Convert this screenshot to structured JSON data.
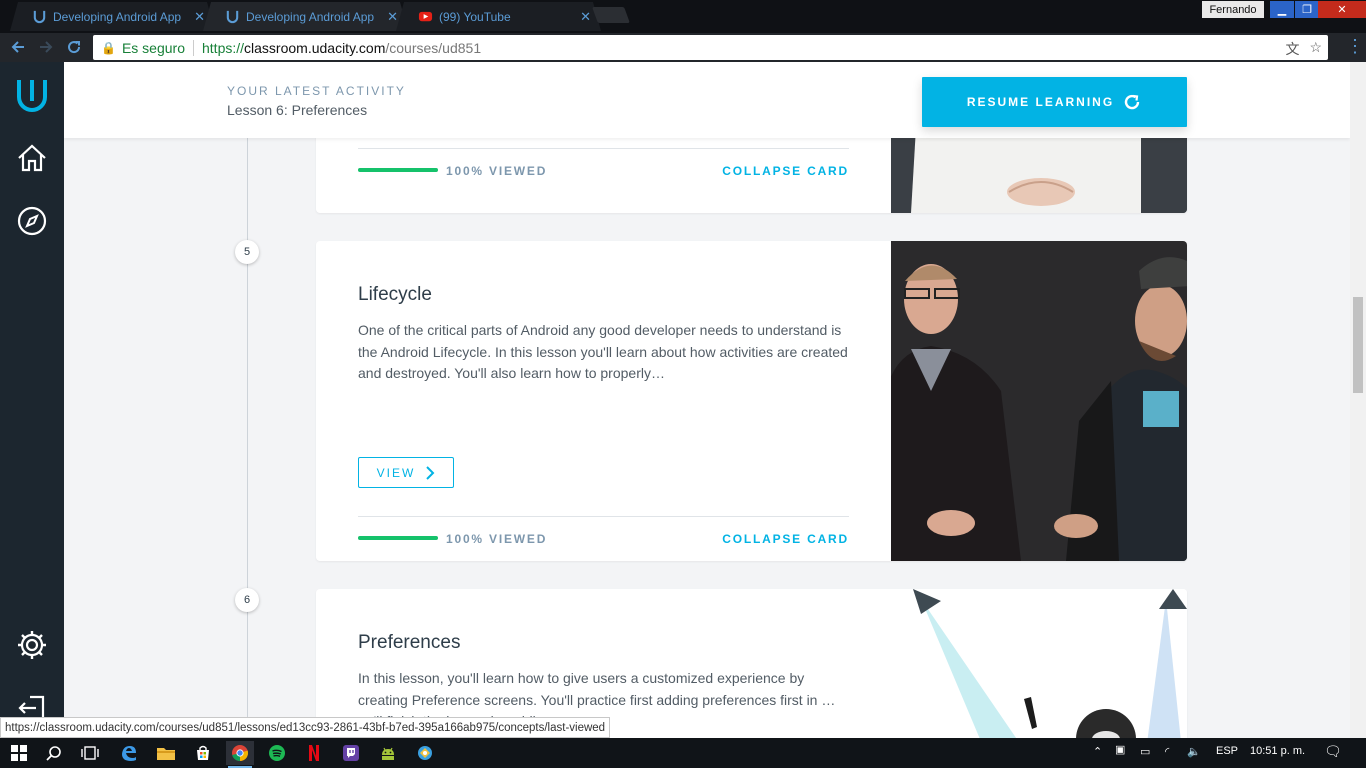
{
  "browser": {
    "tabs": [
      {
        "title": "Developing Android App",
        "favicon": "udacity-logo-icon",
        "active": false
      },
      {
        "title": "Developing Android App",
        "favicon": "udacity-logo-icon",
        "active": true
      },
      {
        "title": "(99) YouTube",
        "favicon": "youtube-icon",
        "active": false
      }
    ],
    "profile_name": "Fernando",
    "security_label": "Es seguro",
    "url_scheme": "https://",
    "url_host": "classroom.udacity.com",
    "url_path": "/courses/ud851",
    "status_url": "https://classroom.udacity.com/courses/ud851/lessons/ed13cc93-2861-43bf-b7ed-395a166ab975/concepts/last-viewed"
  },
  "sidebar": {
    "items": [
      {
        "icon": "udacity-logo-icon"
      },
      {
        "icon": "home-icon"
      },
      {
        "icon": "compass-icon"
      },
      {
        "icon": "gear-icon"
      },
      {
        "icon": "logout-icon"
      }
    ]
  },
  "activity": {
    "label": "YOUR LATEST ACTIVITY",
    "lesson": "Lesson 6: Preferences",
    "resume_label": "RESUME LEARNING"
  },
  "lessons": [
    {
      "number": "",
      "viewed_label": "100% VIEWED",
      "progress": 1.0,
      "collapse_label": "COLLAPSE CARD"
    },
    {
      "number": "5",
      "title": "Lifecycle",
      "description": "One of the critical parts of Android any good developer needs to understand is the Android Lifecycle. In this lesson you'll learn about how activities are created and destroyed. You'll also learn how to properly…",
      "view_label": "VIEW",
      "viewed_label": "100% VIEWED",
      "progress": 1.0,
      "collapse_label": "COLLAPSE CARD"
    },
    {
      "number": "6",
      "title": "Preferences",
      "description": "In this lesson, you'll learn how to give users a customized experience by creating Preference screens. You'll practice first adding preferences first in …ou'll finish the lesson by addin…"
    }
  ],
  "taskbar": {
    "language": "ESP",
    "clock": "10:51 p. m."
  },
  "colors": {
    "accent": "#02b3e4",
    "progress": "#15c26b",
    "sidebar": "#1c262f"
  }
}
